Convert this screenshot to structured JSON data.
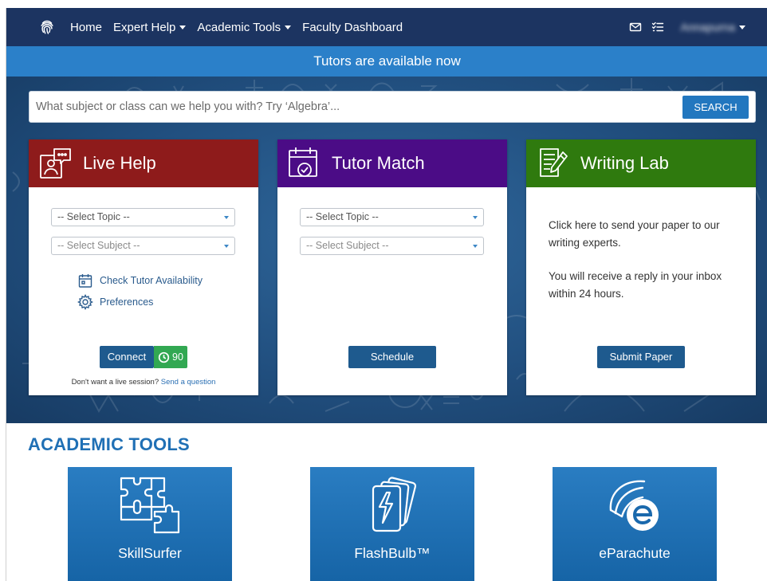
{
  "nav": {
    "links": [
      {
        "label": "Home",
        "dropdown": false
      },
      {
        "label": "Expert Help",
        "dropdown": true
      },
      {
        "label": "Academic Tools",
        "dropdown": true
      },
      {
        "label": "Faculty Dashboard",
        "dropdown": false
      }
    ],
    "user_name": "Annapurna",
    "icons": [
      "fingerprint-logo-icon",
      "mail-icon",
      "checklist-icon"
    ]
  },
  "banner": {
    "text": "Tutors are available now"
  },
  "search": {
    "placeholder": "What subject or class can we help you with? Try ‘Algebra’...",
    "button_label": "SEARCH"
  },
  "cards": {
    "live_help": {
      "title": "Live Help",
      "color": "#8e1b1b",
      "topic_placeholder": "-- Select Topic --",
      "subject_placeholder": "-- Select Subject --",
      "check_label": "Check Tutor Availability",
      "prefs_label": "Preferences",
      "connect_label": "Connect",
      "wait_count": "90",
      "note_text": "Don't want a live session?",
      "note_link": "Send a question"
    },
    "tutor_match": {
      "title": "Tutor Match",
      "color": "#4b0c86",
      "topic_placeholder": "-- Select Topic --",
      "subject_placeholder": "-- Select Subject --",
      "schedule_label": "Schedule"
    },
    "writing_lab": {
      "title": "Writing Lab",
      "color": "#2f7a0e",
      "text_1": "Click here to send your paper to our writing experts.",
      "text_2": "You will receive a reply in your inbox within 24 hours.",
      "submit_label": "Submit Paper"
    }
  },
  "academic_tools": {
    "title": "ACADEMIC TOOLS",
    "tiles": [
      {
        "label": "SkillSurfer",
        "icon": "puzzle-icon"
      },
      {
        "label": "FlashBulb™",
        "icon": "flashcards-icon"
      },
      {
        "label": "eParachute",
        "icon": "eparachute-icon"
      }
    ]
  },
  "colors": {
    "nav_bg": "#1c3461",
    "banner_bg": "#2b80c9",
    "accent": "#2070b5",
    "button_dark": "#1e5a8e",
    "count_green": "#32a852"
  }
}
